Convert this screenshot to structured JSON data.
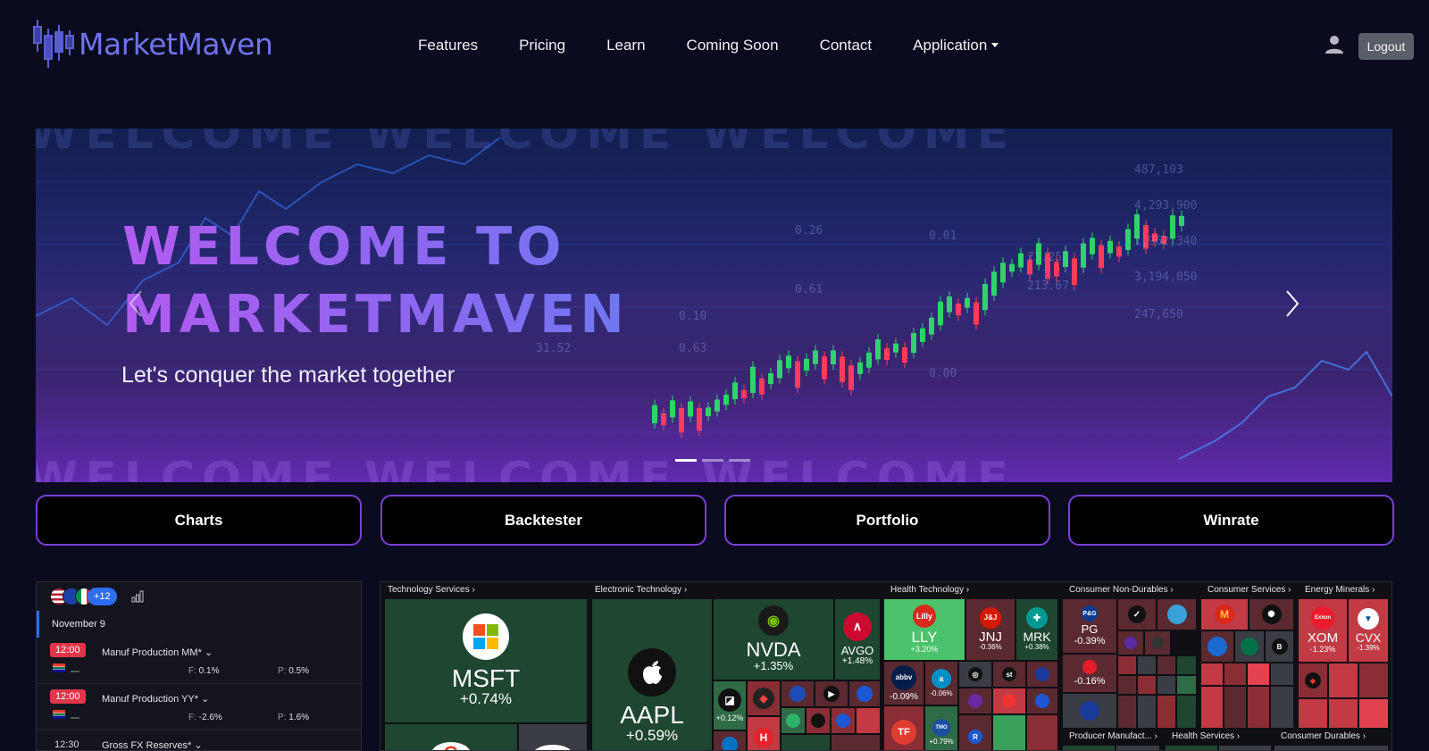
{
  "brand": {
    "name": "MarketMaven"
  },
  "nav": {
    "items": [
      "Features",
      "Pricing",
      "Learn",
      "Coming Soon",
      "Contact"
    ],
    "application_label": "Application",
    "logout_label": "Logout"
  },
  "hero": {
    "title_line1": "WELCOME TO",
    "title_line2": "MARKETMAVEN",
    "subtitle": "Let's conquer the market together",
    "background_text": "WELCOME WELCOME WELCOME",
    "slide_count": 3,
    "active_slide": 1,
    "chart_numbers": [
      "4,293,900",
      "1,962,340",
      "3,194,050",
      "247,650",
      "487,103",
      "0.01",
      "0.63",
      "0.10",
      "31.52",
      "0.26",
      "0.61",
      "0.00",
      "213.67",
      "73.25"
    ]
  },
  "features": [
    "Charts",
    "Backtester",
    "Portfolio",
    "Winrate"
  ],
  "calendar": {
    "extra_countries": "+12",
    "date": "November 9",
    "events": [
      {
        "time": "12:00",
        "name": "Manuf Production MM*",
        "forecast": "0.1%",
        "previous": "0.5%",
        "highlight": true
      },
      {
        "time": "12:00",
        "name": "Manuf Production YY*",
        "forecast": "-2.6%",
        "previous": "1.6%",
        "highlight": true
      },
      {
        "time": "12:30",
        "name": "Gross FX Reserves*",
        "highlight": false
      }
    ],
    "forecast_prefix": "F:",
    "previous_prefix": "P:"
  },
  "heatmap": {
    "sectors": {
      "tech_services": "Technology Services",
      "electronic_tech": "Electronic Technology",
      "health_tech": "Health Technology",
      "consumer_non_durables": "Consumer Non-Durables",
      "consumer_services": "Consumer Services",
      "energy_minerals": "Energy Minerals",
      "producer_manuf": "Producer Manufact...",
      "health_services": "Health Services",
      "consumer_durables": "Consumer Durables"
    },
    "tiles": {
      "msft": {
        "ticker": "MSFT",
        "change": "+0.74%"
      },
      "aapl": {
        "ticker": "AAPL",
        "change": "+0.59%"
      },
      "nvda": {
        "ticker": "NVDA",
        "change": "+1.35%"
      },
      "avgo": {
        "ticker": "AVGO",
        "change": "+1.48%"
      },
      "lly": {
        "ticker": "LLY",
        "change": "+3.20%"
      },
      "jnj": {
        "ticker": "JNJ",
        "change": "-0.36%"
      },
      "mrk": {
        "ticker": "MRK",
        "change": "+0.38%"
      },
      "pg": {
        "ticker": "PG",
        "change": "-0.39%"
      },
      "ko": {
        "change": "-0.16%"
      },
      "abbv": {
        "change": "-0.09%"
      },
      "abt": {
        "change": "-0.06%"
      },
      "amd": {
        "change": "+0.12%"
      },
      "tmo": {
        "change": "+0.79%"
      },
      "xom": {
        "ticker": "XOM",
        "change": "-1.23%"
      },
      "cvx": {
        "ticker": "CVX",
        "change": "-1.39%"
      }
    }
  },
  "colors": {
    "background": "#0b0b20",
    "brand": "#6f74e8",
    "accent_border": "#7a3fd8",
    "up": "#3aa05c",
    "down": "#c13a44",
    "event_badge": "#e0364a"
  }
}
